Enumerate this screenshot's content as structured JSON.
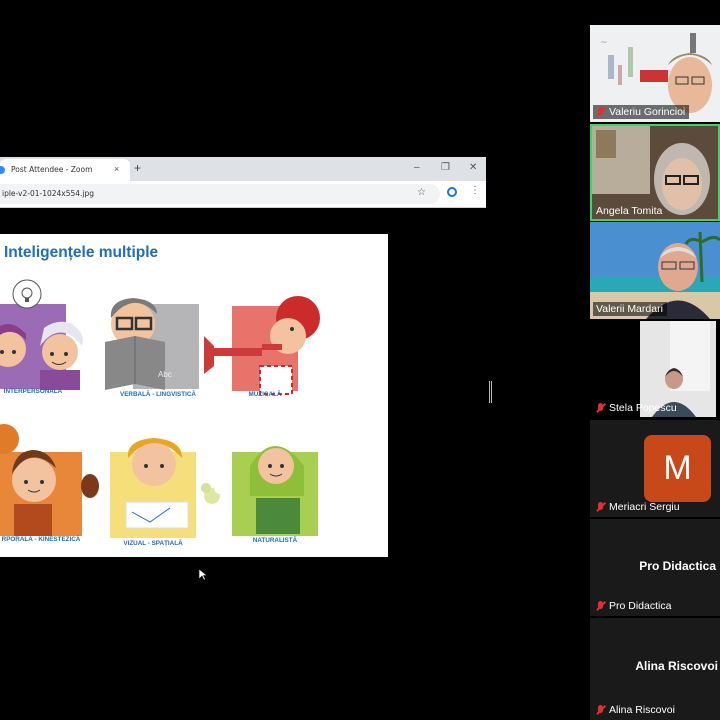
{
  "browser": {
    "tab_title": "Post Attendee - Zoom",
    "tab_close": "×",
    "new_tab": "+",
    "minimize": "–",
    "restore": "❐",
    "close": "✕",
    "url": "iple-v2-01-1024x554.jpg",
    "star": "☆",
    "menu": "⋮"
  },
  "slide": {
    "title": "Inteligențele multiple",
    "panels": [
      {
        "caption": "INTERPERSONALĂ",
        "color": "#9b6bb5"
      },
      {
        "caption": "VERBALĂ - LINGVISTICĂ",
        "color": "#b5b5b8"
      },
      {
        "caption": "MUZICALĂ",
        "color": "#e8736b"
      },
      {
        "caption": "RPORALĂ - KINESTEZICĂ",
        "color": "#e8863a"
      },
      {
        "caption": "VIZUAL - SPAȚIALĂ",
        "color": "#f6df7a"
      },
      {
        "caption": "NATURALISTĂ",
        "color": "#a9cf52"
      }
    ],
    "book_text": "Abc"
  },
  "participants": [
    {
      "name": "Valeriu Gorincioi",
      "muted": true
    },
    {
      "name": "Angela Tomita",
      "muted": false
    },
    {
      "name": "Valerii Mardari",
      "muted": false
    },
    {
      "name": "Stela Popescu",
      "muted": true
    },
    {
      "name": "Meriacri Sergiu",
      "muted": true,
      "avatar_letter": "M",
      "avatar_color": "#c8481a"
    },
    {
      "name": "Pro Didactica",
      "muted": true,
      "display": "Pro Didactica"
    },
    {
      "name": "Alina Riscovoi",
      "muted": true,
      "display": "Alina Riscovoi"
    }
  ]
}
